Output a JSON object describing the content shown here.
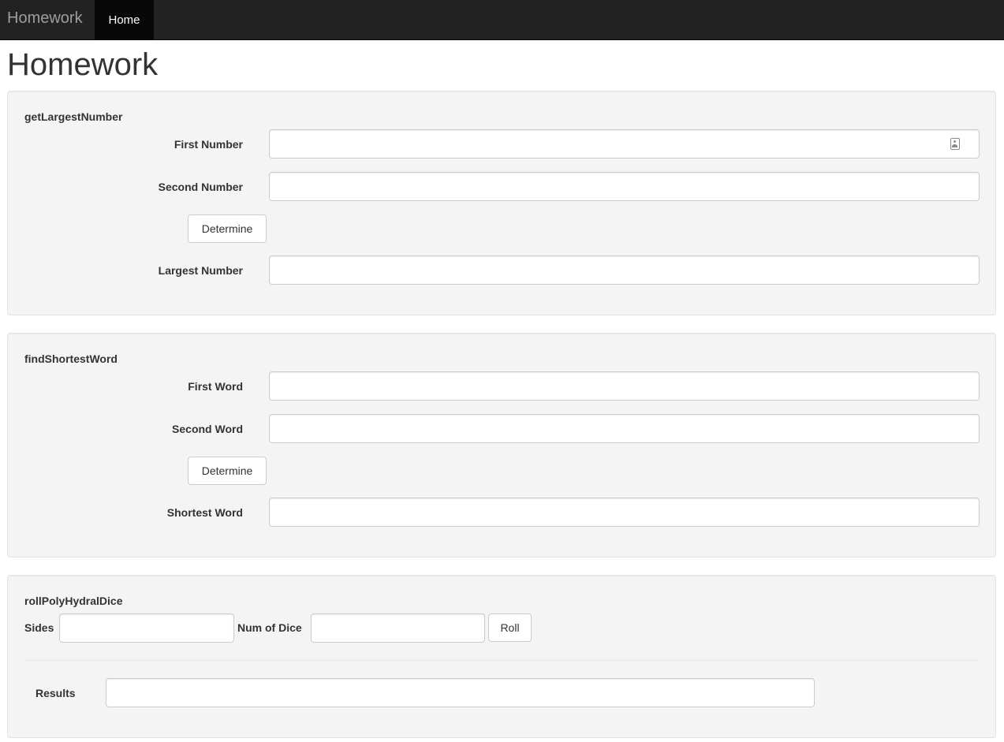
{
  "navbar": {
    "brand": "Homework",
    "home": "Home"
  },
  "page": {
    "title": "Homework"
  },
  "largest": {
    "legend": "getLargestNumber",
    "first_label": "First Number",
    "second_label": "Second Number",
    "button": "Determine",
    "result_label": "Largest Number"
  },
  "shortest": {
    "legend": "findShortestWord",
    "first_label": "First Word",
    "second_label": "Second Word",
    "button": "Determine",
    "result_label": "Shortest Word"
  },
  "dice": {
    "legend": "rollPolyHydralDice",
    "sides_label": "Sides",
    "num_label": "Num of Dice",
    "button": "Roll",
    "results_label": "Results"
  },
  "icons": {
    "first_number_field": "contact-card-icon"
  }
}
